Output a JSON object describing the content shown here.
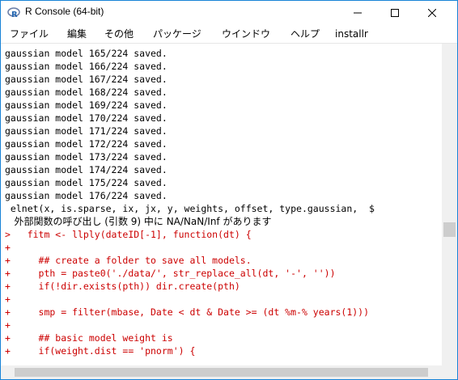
{
  "window": {
    "title": "R Console (64-bit)",
    "accent": "#1883d7"
  },
  "menu": [
    "ファイル",
    "編集",
    "その他",
    "パッケージ",
    "ウインドウ",
    "ヘルプ",
    "installr"
  ],
  "console_lines": [
    {
      "text": "gaussian model 165/224 saved.",
      "color": "black"
    },
    {
      "text": "gaussian model 166/224 saved.",
      "color": "black"
    },
    {
      "text": "gaussian model 167/224 saved.",
      "color": "black"
    },
    {
      "text": "gaussian model 168/224 saved.",
      "color": "black"
    },
    {
      "text": "gaussian model 169/224 saved.",
      "color": "black"
    },
    {
      "text": "gaussian model 170/224 saved.",
      "color": "black"
    },
    {
      "text": "gaussian model 171/224 saved.",
      "color": "black"
    },
    {
      "text": "gaussian model 172/224 saved.",
      "color": "black"
    },
    {
      "text": "gaussian model 173/224 saved.",
      "color": "black"
    },
    {
      "text": "gaussian model 174/224 saved.",
      "color": "black"
    },
    {
      "text": "gaussian model 175/224 saved.",
      "color": "black"
    },
    {
      "text": "gaussian model 176/224 saved.",
      "color": "black"
    },
    {
      "text": " elnet(x, is.sparse, ix, jx, y, weights, offset, type.gaussian,  $",
      "color": "black"
    },
    {
      "text": "   外部関数の呼び出し (引数 9) 中に NA/NaN/Inf があります",
      "color": "black",
      "jp": true
    },
    {
      "text": ">   fitm <- llply(dateID[-1], function(dt) {",
      "color": "red"
    },
    {
      "text": "+",
      "color": "red"
    },
    {
      "text": "+     ## create a folder to save all models.",
      "color": "red"
    },
    {
      "text": "+     pth = paste0('./data/', str_replace_all(dt, '-', ''))",
      "color": "red"
    },
    {
      "text": "+     if(!dir.exists(pth)) dir.create(pth)",
      "color": "red"
    },
    {
      "text": "+",
      "color": "red"
    },
    {
      "text": "+     smp = filter(mbase, Date < dt & Date >= (dt %m-% years(1)))",
      "color": "red"
    },
    {
      "text": "+",
      "color": "red"
    },
    {
      "text": "+     ## basic model weight is",
      "color": "red"
    },
    {
      "text": "+     if(weight.dist == 'pnorm') {",
      "color": "red"
    }
  ],
  "colors": {
    "output": "#000000",
    "input": "#cc0000"
  }
}
